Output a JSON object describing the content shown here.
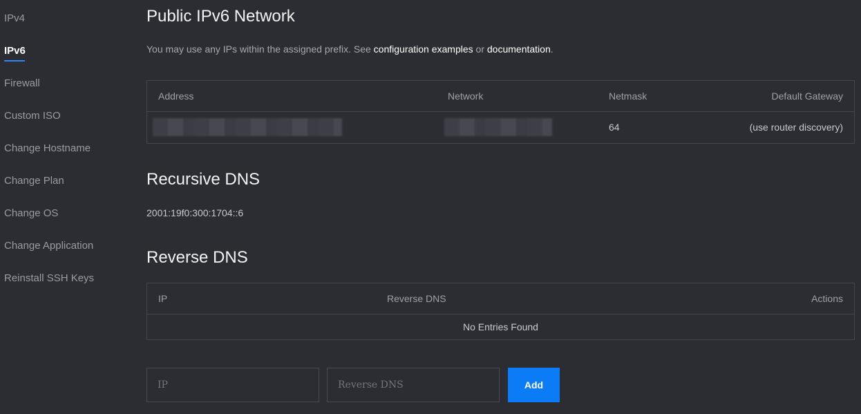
{
  "sidebar": {
    "items": [
      {
        "label": "IPv4"
      },
      {
        "label": "IPv6"
      },
      {
        "label": "Firewall"
      },
      {
        "label": "Custom ISO"
      },
      {
        "label": "Change Hostname"
      },
      {
        "label": "Change Plan"
      },
      {
        "label": "Change OS"
      },
      {
        "label": "Change Application"
      },
      {
        "label": "Reinstall SSH Keys"
      }
    ],
    "active_index": 1,
    "accent_color": "#2f86f0"
  },
  "ipv6": {
    "title": "Public IPv6 Network",
    "desc_prefix": "You may use any IPs within the assigned prefix. See ",
    "link_config": "configuration examples",
    "desc_or": " or ",
    "link_docs": "documentation",
    "desc_suffix": ".",
    "table": {
      "headers": {
        "address": "Address",
        "network": "Network",
        "netmask": "Netmask",
        "gateway": "Default Gateway"
      },
      "row": {
        "netmask": "64",
        "gateway": "(use router discovery)"
      }
    }
  },
  "recursive_dns": {
    "title": "Recursive DNS",
    "value": "2001:19f0:300:1704::6"
  },
  "reverse_dns": {
    "title": "Reverse DNS",
    "headers": {
      "ip": "IP",
      "reverse": "Reverse DNS",
      "actions": "Actions"
    },
    "empty": "No Entries Found",
    "form": {
      "ip_placeholder": "IP",
      "reverse_placeholder": "Reverse DNS",
      "add_label": "Add",
      "add_color": "#0b7cf5"
    }
  }
}
